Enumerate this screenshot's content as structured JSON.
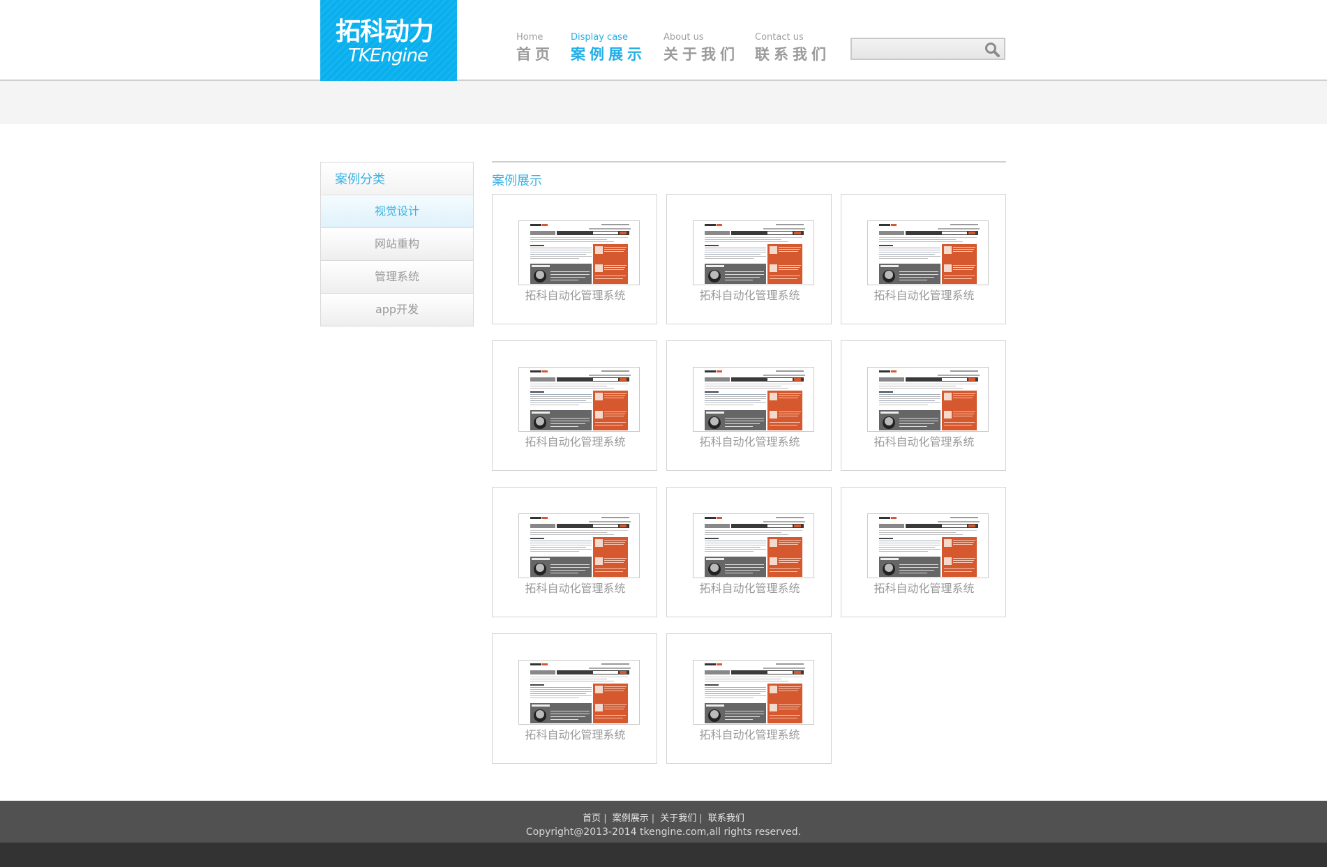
{
  "logo": {
    "cn": "拓科动力",
    "en": "TKEngine"
  },
  "nav": [
    {
      "en": "Home",
      "cn": "首页",
      "active": false
    },
    {
      "en": "Display case",
      "cn": "案例展示",
      "active": true
    },
    {
      "en": "About us",
      "cn": "关于我们",
      "active": false
    },
    {
      "en": "Contact us",
      "cn": "联系我们",
      "active": false
    }
  ],
  "search": {
    "value": "",
    "icon": "search-icon"
  },
  "sidebar": {
    "title": "案例分类",
    "items": [
      {
        "label": "视觉设计",
        "active": true
      },
      {
        "label": "网站重构",
        "active": false
      },
      {
        "label": "管理系统",
        "active": false
      },
      {
        "label": "app开发",
        "active": false
      }
    ]
  },
  "cases": {
    "title": "案例展示",
    "items": [
      {
        "label": "拓科自动化管理系统"
      },
      {
        "label": "拓科自动化管理系统"
      },
      {
        "label": "拓科自动化管理系统"
      },
      {
        "label": "拓科自动化管理系统"
      },
      {
        "label": "拓科自动化管理系统"
      },
      {
        "label": "拓科自动化管理系统"
      },
      {
        "label": "拓科自动化管理系统"
      },
      {
        "label": "拓科自动化管理系统"
      },
      {
        "label": "拓科自动化管理系统"
      },
      {
        "label": "拓科自动化管理系统"
      },
      {
        "label": "拓科自动化管理系统"
      }
    ]
  },
  "footer": {
    "links": [
      "首页",
      "案例展示",
      "关于我们",
      "联系我们"
    ],
    "separator": "|",
    "copyright": "Copyright@2013-2014 tkengine.com,all rights reserved."
  },
  "colors": {
    "accent": "#0ab0ee",
    "text_accent": "#3ab2e3",
    "footer": "#515151",
    "footer_bottom": "#333333"
  }
}
